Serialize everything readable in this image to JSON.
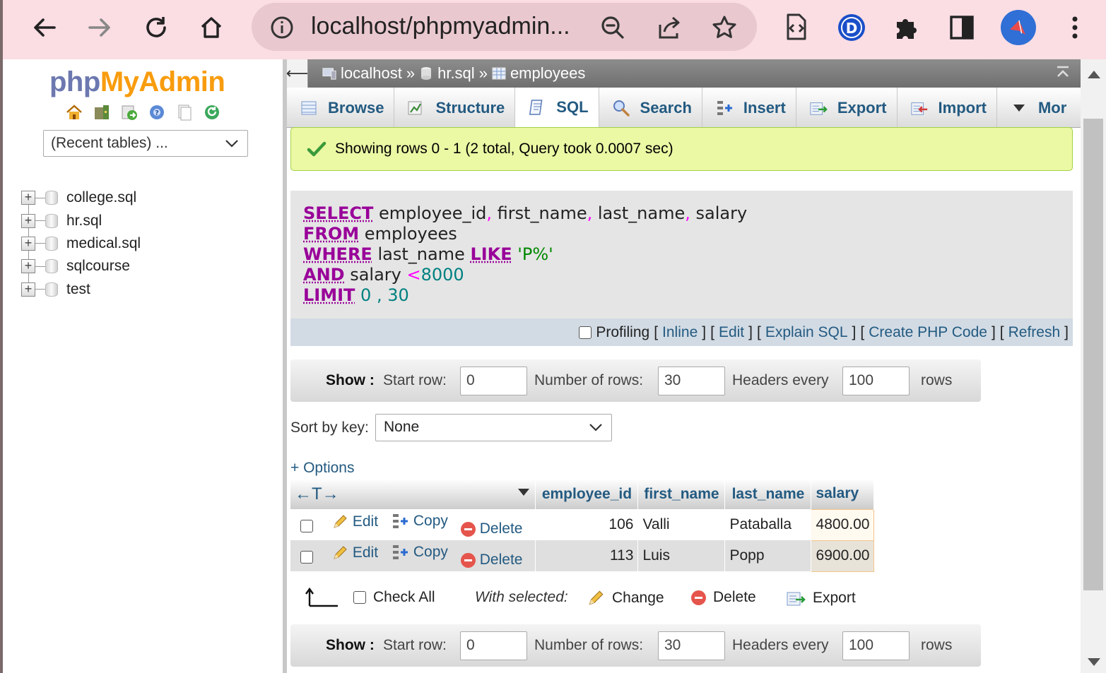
{
  "browser": {
    "url": "localhost/phpmyadmin...",
    "profile_color": "#2f6fd6",
    "ext_letter": "D"
  },
  "sidebar": {
    "logo_php": "php",
    "logo_myadmin": "MyAdmin",
    "recent_tables": "(Recent tables) ...",
    "databases": [
      {
        "name": "college.sql"
      },
      {
        "name": "hr.sql"
      },
      {
        "name": "medical.sql"
      },
      {
        "name": "sqlcourse"
      },
      {
        "name": "test"
      }
    ]
  },
  "breadcrumb": {
    "server": "localhost",
    "database": "hr.sql",
    "table": "employees",
    "sep": "»"
  },
  "tabs": [
    {
      "label": "Browse",
      "icon": "browse-icon"
    },
    {
      "label": "Structure",
      "icon": "structure-icon"
    },
    {
      "label": "SQL",
      "icon": "sql-icon",
      "active": true
    },
    {
      "label": "Search",
      "icon": "search-icon"
    },
    {
      "label": "Insert",
      "icon": "insert-icon"
    },
    {
      "label": "Export",
      "icon": "export-icon"
    },
    {
      "label": "Import",
      "icon": "import-icon"
    },
    {
      "label": "Mor",
      "icon": "more-caret-icon"
    }
  ],
  "message": "Showing rows 0 - 1 (2 total, Query took 0.0007 sec)",
  "sql": {
    "select_kw": "SELECT",
    "select_cols_1": " employee_id",
    "comma": ",",
    "select_cols_2": " first_name",
    "select_cols_3": " last_name",
    "select_cols_4": " salary",
    "from_kw": "FROM",
    "from_table": " employees",
    "where_kw": "WHERE",
    "where_col": " last_name ",
    "like_kw": "LIKE",
    "like_val": " 'P%'",
    "and_kw": "AND",
    "and_col": " salary ",
    "lt": "<",
    "lt_val": "8000",
    "limit_kw": "LIMIT",
    "limit_a": " 0",
    "limit_sep": " , ",
    "limit_b": "30"
  },
  "sql_footer": {
    "profiling": "Profiling",
    "inline": "Inline",
    "edit": "Edit",
    "explain": "Explain SQL",
    "php": "Create PHP Code",
    "refresh": "Refresh",
    "lb": "[",
    "rb": "]"
  },
  "nav": {
    "show": "Show :",
    "start_row_label": "Start row:",
    "start_row": "0",
    "num_rows_label": "Number of rows:",
    "num_rows": "30",
    "headers_label": "Headers every",
    "headers": "100",
    "rows": "rows"
  },
  "sort": {
    "label": "Sort by key:",
    "value": "None"
  },
  "options_link": "+ Options",
  "table": {
    "columns": [
      "employee_id",
      "first_name",
      "last_name",
      "salary"
    ],
    "rows": [
      {
        "employee_id": "106",
        "first_name": "Valli",
        "last_name": "Pataballa",
        "salary": "4800.00"
      },
      {
        "employee_id": "113",
        "first_name": "Luis",
        "last_name": "Popp",
        "salary": "6900.00"
      }
    ],
    "edit": "Edit",
    "copy": "Copy",
    "delete": "Delete",
    "col_arrows": "←T→"
  },
  "with_selected": {
    "check_all": "Check All",
    "label": "With selected:",
    "change": "Change",
    "delete": "Delete",
    "export": "Export"
  }
}
